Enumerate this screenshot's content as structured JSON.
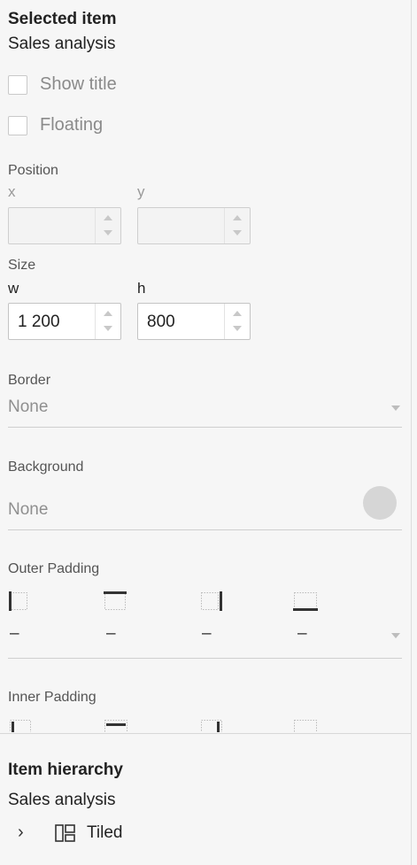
{
  "selected_item": {
    "heading": "Selected item",
    "name": "Sales analysis",
    "show_title_label": "Show title",
    "floating_label": "Floating"
  },
  "position": {
    "label": "Position",
    "x_label": "x",
    "y_label": "y",
    "x_value": "",
    "y_value": ""
  },
  "size": {
    "label": "Size",
    "w_label": "w",
    "h_label": "h",
    "w_value": "1 200",
    "h_value": "800"
  },
  "border": {
    "label": "Border",
    "value": "None"
  },
  "background": {
    "label": "Background",
    "value": "None",
    "swatch_color": "#d6d6d6"
  },
  "outer_padding": {
    "label": "Outer Padding",
    "left": "–",
    "top": "–",
    "right": "–",
    "bottom": "–"
  },
  "inner_padding": {
    "label": "Inner Padding"
  },
  "hierarchy": {
    "heading": "Item hierarchy",
    "root": "Sales analysis",
    "child_label": "Tiled",
    "expand_glyph": "›"
  }
}
